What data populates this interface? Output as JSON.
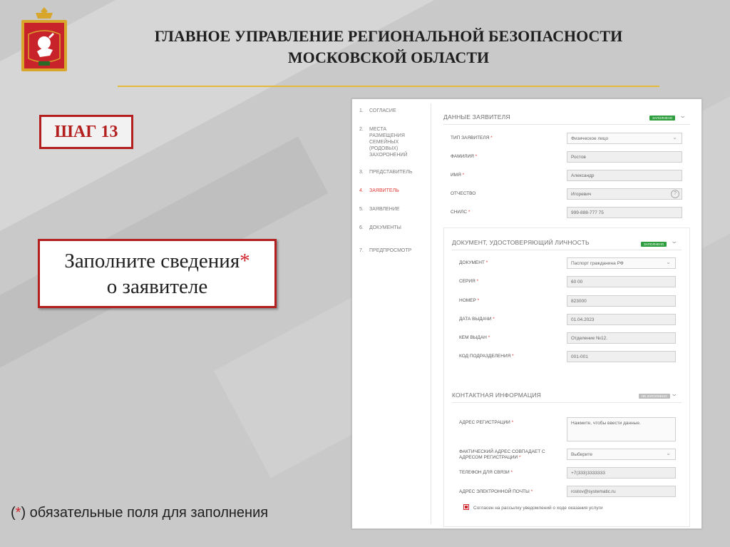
{
  "header": {
    "title_line1": "ГЛАВНОЕ УПРАВЛЕНИЕ РЕГИОНАЛЬНОЙ БЕЗОПАСНОСТИ",
    "title_line2": "МОСКОВСКОЙ ОБЛАСТИ"
  },
  "step_label": "ШАГ 13",
  "instruction": {
    "line1": "Заполните сведения",
    "star": "*",
    "line2": "о заявителе"
  },
  "footnote": {
    "open": "(",
    "star": "*",
    "text": ") обязательные поля для заполнения"
  },
  "colors": {
    "accent_red": "#b31f1f",
    "gold_line": "#e5b93a",
    "badge_green": "#2e9e3e",
    "badge_gray": "#bdbdbd"
  },
  "form": {
    "steps": [
      {
        "num": "1.",
        "label": "СОГЛАСИЕ"
      },
      {
        "num": "2.",
        "label": "МЕСТА РАЗМЕЩЕНИЯ СЕМЕЙНЫХ (РОДОВЫХ) ЗАХОРОНЕНИЙ"
      },
      {
        "num": "3.",
        "label": "ПРЕДСТАВИТЕЛЬ"
      },
      {
        "num": "4.",
        "label": "ЗАЯВИТЕЛЬ"
      },
      {
        "num": "5.",
        "label": "ЗАЯВЛЕНИЕ"
      },
      {
        "num": "6.",
        "label": "ДОКУМЕНТЫ"
      },
      {
        "num": "7.",
        "label": "ПРЕДПРОСМОТР"
      }
    ],
    "applicant": {
      "heading": "ДАННЫЕ ЗАЯВИТЕЛЯ",
      "badge": "ЗАПОЛНЕНО",
      "fields": [
        {
          "label": "ТИП ЗАЯВИТЕЛЯ",
          "required": "*",
          "value": "Физическое лицо"
        },
        {
          "label": "ФАМИЛИЯ",
          "required": "*",
          "value": "Ростов"
        },
        {
          "label": "ИМЯ",
          "required": "*",
          "value": "Александр"
        },
        {
          "label": "ОТЧЕСТВО",
          "required": "",
          "value": "Игоревич"
        },
        {
          "label": "СНИЛС",
          "required": "*",
          "value": "999-888-777 75"
        }
      ]
    },
    "identity": {
      "heading": "ДОКУМЕНТ, УДОСТОВЕРЯЮЩИЙ ЛИЧНОСТЬ",
      "badge": "ЗАПОЛНЕНО",
      "fields": [
        {
          "label": "ДОКУМЕНТ",
          "required": "*",
          "value": "Паспорт гражданина РФ"
        },
        {
          "label": "СЕРИЯ",
          "required": "*",
          "value": "60 00"
        },
        {
          "label": "НОМЕР",
          "required": "*",
          "value": "823000"
        },
        {
          "label": "ДАТА ВЫДАЧИ",
          "required": "*",
          "value": "01.04.2023"
        },
        {
          "label": "КЕМ ВЫДАН",
          "required": "*",
          "value": "Отделение №12."
        },
        {
          "label": "КОД ПОДРАЗДЕЛЕНИЯ",
          "required": "*",
          "value": "001-001"
        }
      ]
    },
    "contact": {
      "heading": "КОНТАКТНАЯ ИНФОРМАЦИЯ",
      "badge": "НЕ ЗАПОЛНЕНО",
      "fields": [
        {
          "label": "АДРЕС РЕГИСТРАЦИИ",
          "required": "*",
          "placeholder": "Нажмите, чтобы ввести данные."
        },
        {
          "label_line1": "ФАКТИЧЕСКИЙ АДРЕС СОВПАДАЕТ С",
          "label_line2": "АДРЕСОМ РЕГИСТРАЦИИ",
          "required": "*",
          "value": "Выберите"
        },
        {
          "label": "ТЕЛЕФОН ДЛЯ СВЯЗИ",
          "required": "*",
          "value": "+7(333)3333333"
        },
        {
          "label": "АДРЕС ЭЛЕКТРОННОЙ ПОЧТЫ",
          "required": "*",
          "value": "rostov@systematic.ru"
        }
      ],
      "consent": "Согласен на рассылку уведомлений о ходе оказания услуги"
    }
  }
}
